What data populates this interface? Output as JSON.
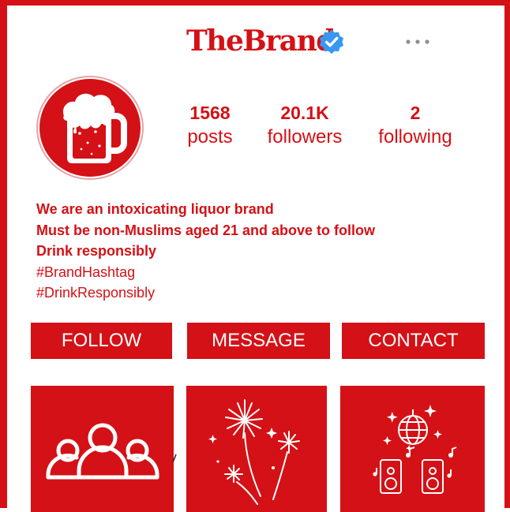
{
  "profile": {
    "brand_name": "TheBrand",
    "verified": true,
    "more_icon": "more-horizontal-icon",
    "avatar_icon": "beer-mug-icon"
  },
  "stats": {
    "posts": {
      "count": "1568",
      "label": "posts"
    },
    "followers": {
      "count": "20.1K",
      "label": "followers"
    },
    "following": {
      "count": "2",
      "label": "following"
    }
  },
  "bio": {
    "line1": "We are an intoxicating liquor brand",
    "line2": "Must be non-Muslims aged 21 and above to follow",
    "line3": "Drink responsibly",
    "hashtag1": "#BrandHashtag",
    "hashtag2": "#DrinkResponsibly"
  },
  "actions": {
    "follow": "FOLLOW",
    "message": "MESSAGE",
    "contact": "CONTACT"
  },
  "grid": {
    "tiles": [
      {
        "icon": "people-group-icon"
      },
      {
        "icon": "fireworks-icon"
      },
      {
        "icon": "disco-ball-speakers-icon"
      }
    ]
  },
  "colors": {
    "brand_red": "#d41116",
    "verified_blue": "#3897f0",
    "background": "#ffffff"
  }
}
